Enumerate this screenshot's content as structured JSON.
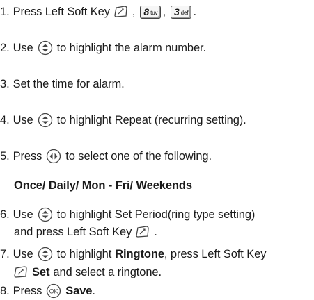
{
  "steps": [
    {
      "num": "1.",
      "pre": "Press Left Soft Key",
      "key1": "8",
      "key1_sub": "tuv",
      "key2": "3",
      "key2_sub": "def",
      "sep": ",",
      "end": "."
    },
    {
      "num": "2.",
      "pre": "Use",
      "post": "to highlight the alarm number."
    },
    {
      "num": "3.",
      "text": "Set the time for alarm."
    },
    {
      "num": "4.",
      "pre": "Use",
      "post": "to highlight Repeat (recurring setting)."
    },
    {
      "num": "5.",
      "pre": "Press",
      "post": "to select one of the following."
    },
    {
      "options": "Once/ Daily/ Mon - Fri/ Weekends"
    },
    {
      "num": "6.",
      "pre": "Use",
      "post": "to highlight Set Period(ring type setting)",
      "line2": "and press Left Soft Key",
      "end": "."
    },
    {
      "num": "7.",
      "pre": "Use",
      "mid": "to highlight",
      "bold": "Ringtone",
      "post": ", press Left Soft Key",
      "line2_bold": "Set",
      "line2": "and select a ringtone."
    },
    {
      "num": "8.",
      "pre": "Press",
      "bold": "Save",
      "end": "."
    }
  ],
  "icons": {
    "soft_key": "left-soft-key-icon",
    "nav_updown": "nav-up-down-icon",
    "nav_leftright": "nav-left-right-icon",
    "ok": "ok-key-icon"
  }
}
